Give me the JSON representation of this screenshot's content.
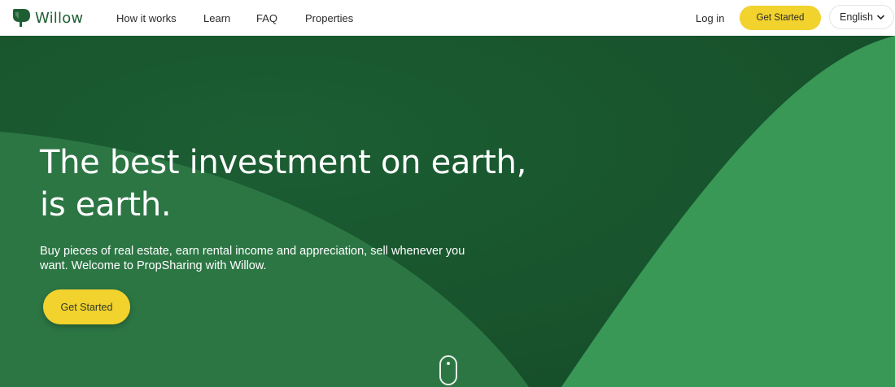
{
  "brand": {
    "name": "Willow"
  },
  "nav": {
    "links": [
      "How it works",
      "Learn",
      "FAQ",
      "Properties"
    ],
    "login_label": "Log in",
    "cta_label": "Get Started",
    "language": {
      "selected": "English",
      "icon": "chevron-down-icon"
    }
  },
  "hero": {
    "title_line1": "The best investment on earth,",
    "title_line2": "is earth.",
    "subtitle": "Buy pieces of real estate, earn rental income and appreciation, sell whenever you want. Welcome to PropSharing with Willow.",
    "cta_label": "Get Started",
    "scroll_icon": "mouse-scroll-icon"
  },
  "colors": {
    "brand_green": "#1d5f33",
    "hero_dark_green": "#19582f",
    "hero_mid_green": "#2d7a46",
    "hero_light_green": "#3c9b59",
    "accent_yellow": "#f2d22c"
  }
}
